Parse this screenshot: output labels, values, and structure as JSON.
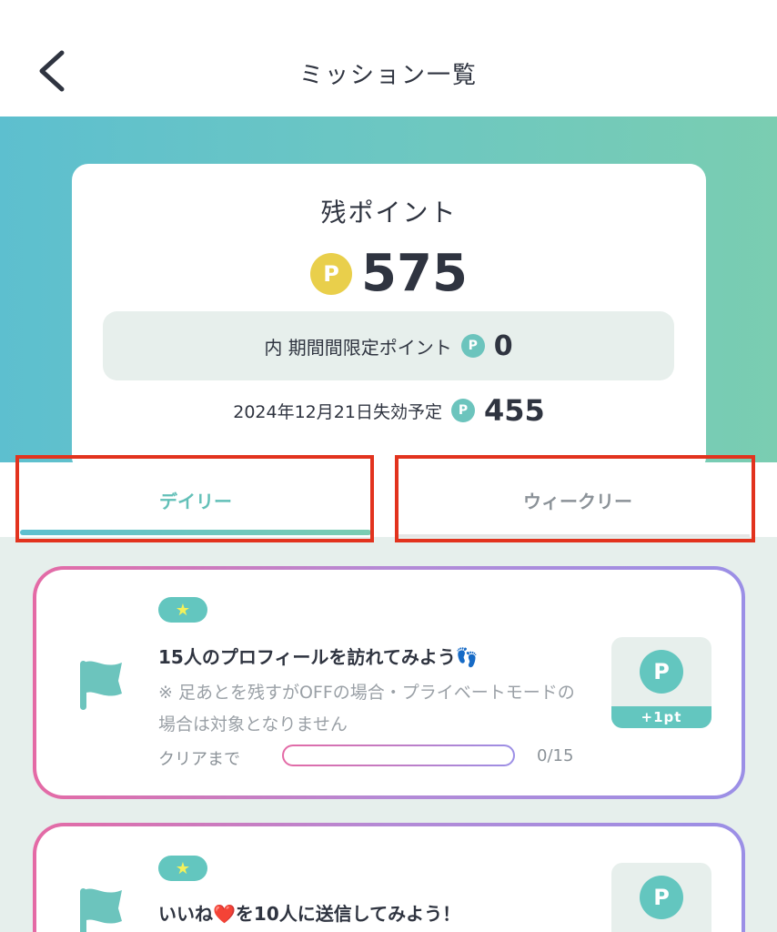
{
  "header": {
    "title": "ミッション一覧",
    "back_icon": "chevron-left-icon"
  },
  "points": {
    "label": "残ポイント",
    "coin_symbol": "P",
    "total": "575",
    "limited_label": "内 期間間限定ポイント",
    "limited_value": "0",
    "expire_label": "2024年12月21日失効予定",
    "expire_value": "455"
  },
  "tabs": [
    {
      "label": "デイリー",
      "active": true
    },
    {
      "label": "ウィークリー",
      "active": false
    }
  ],
  "missions": [
    {
      "badge": "★",
      "title": "15人のプロフィールを訪れてみよう👣",
      "note": "※ 足あとを残すがOFFの場合・プライベートモードの場合は対象となりません",
      "progress_label": "クリアまで",
      "progress_count": "0/15",
      "progress": 0,
      "reward_coin": "P",
      "reward": "+1pt",
      "flag_icon": "flag-icon"
    },
    {
      "badge": "★",
      "title": "いいね❤️を10人に送信してみよう！",
      "reward_coin": "P",
      "flag_icon": "flag-icon"
    }
  ],
  "colors": {
    "accent": "#63c6bf",
    "coin_gold": "#e9cf4b",
    "highlight_red": "#e2331e"
  }
}
